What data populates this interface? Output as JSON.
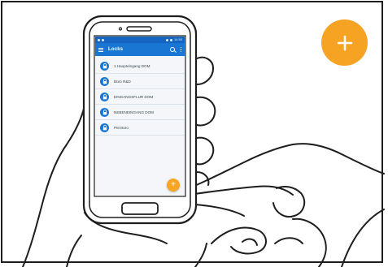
{
  "colors": {
    "accent_orange": "#f6a223",
    "app_blue": "#1976d2",
    "status_blue": "#1565c0",
    "outline": "#1e1e1e"
  },
  "phone": {
    "status_bar": {
      "time": "14:50"
    },
    "app_bar": {
      "title": "Locks",
      "icons": [
        "menu-icon",
        "search-icon",
        "more-vert-icon"
      ]
    },
    "locks": [
      {
        "label": "1 Haupteingang DOM",
        "icon": "lock-icon"
      },
      {
        "label": "Büro R&D",
        "icon": "lock-icon"
      },
      {
        "label": "EINGANGSFLUR DOM",
        "icon": "lock-icon"
      },
      {
        "label": "NEBENEINGANG DOM",
        "icon": "lock-icon"
      },
      {
        "label": "PM Büro",
        "icon": "lock-icon"
      }
    ],
    "fab": {
      "symbol": "+",
      "icon": "plus-icon"
    }
  },
  "callout": {
    "symbol": "+",
    "icon": "plus-icon"
  }
}
